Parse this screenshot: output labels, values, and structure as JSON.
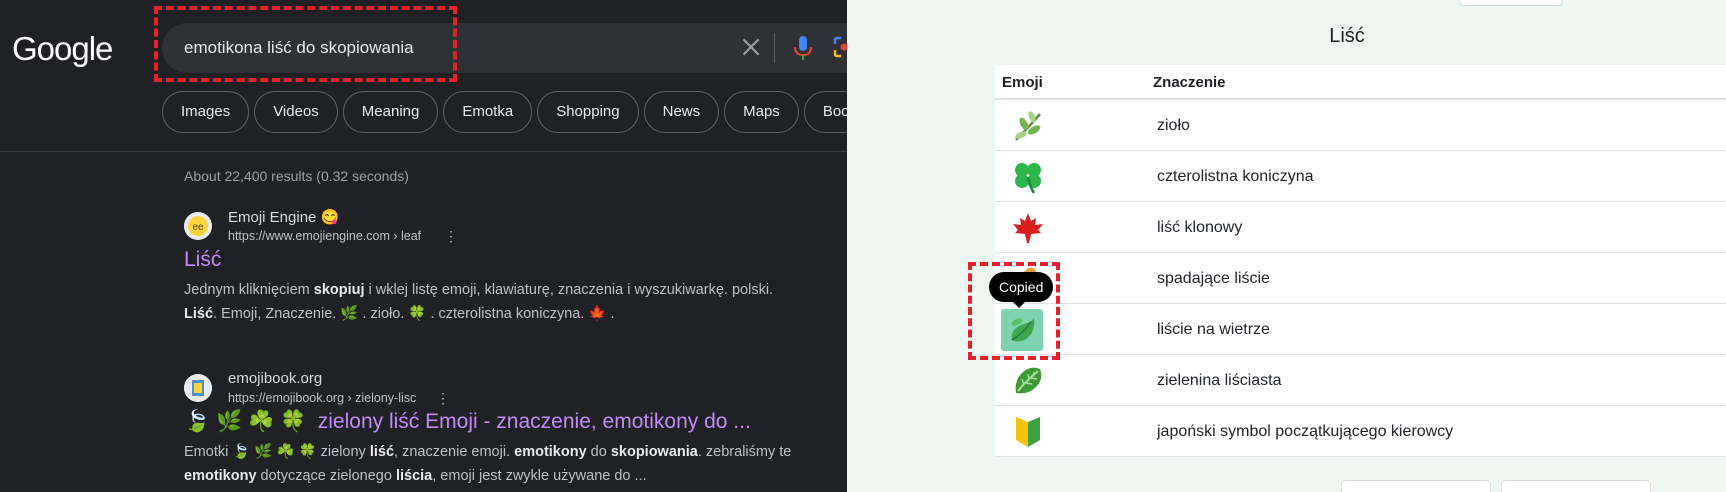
{
  "google": {
    "logo": "Google",
    "query": "emotikona liść do skopiowania",
    "chips": [
      "Images",
      "Videos",
      "Meaning",
      "Emotka",
      "Shopping",
      "News",
      "Maps",
      "Books"
    ],
    "stats": "About 22,400 results (0.32 seconds)",
    "results": [
      {
        "site": "Emoji Engine 😋",
        "url": "https://www.emojiengine.com › leaf",
        "title": "Liść",
        "snippet_parts": [
          "Jednym kliknięciem ",
          "skopiuj",
          " i wklej listę emoji, klawiaturę, znaczenia i wyszukiwarkę. polski. ",
          "Liść",
          ". Emoji, Znaczenie. 🌿 . zioło. 🍀 . czterolistna koniczyna. 🍁 ."
        ]
      },
      {
        "site": "emojibook.org",
        "url": "https://emojibook.org › zielony-lisc",
        "title_emoji": "🍃 🌿 ☘️ 🍀",
        "title": "zielony liść Emoji - znaczenie, emotikony do ...",
        "snippet_parts": [
          "Emotki 🍃 🌿 ☘️ 🍀 zielony ",
          "liść",
          ", znaczenie emoji. ",
          "emotikony",
          " do ",
          "skopiowania",
          ". zebraliśmy te ",
          "emotikony",
          " dotyczące zielonego ",
          "liścia",
          ", emoji jest zwykle używane do ..."
        ]
      }
    ]
  },
  "emoji_page": {
    "title": "Liść",
    "col_emoji": "Emoji",
    "col_meaning": "Znaczenie",
    "rows": [
      {
        "emoji": "herb",
        "meaning": "zioło"
      },
      {
        "emoji": "four-leaf-clover",
        "meaning": "czterolistna koniczyna"
      },
      {
        "emoji": "maple-leaf",
        "meaning": "liść klonowy"
      },
      {
        "emoji": "fallen-leaf",
        "meaning": "spadające liście"
      },
      {
        "emoji": "leaf-fluttering-in-wind",
        "meaning": "liście na wietrze"
      },
      {
        "emoji": "leafy-green",
        "meaning": "zielenina liściasta"
      },
      {
        "emoji": "japanese-beginner-symbol",
        "meaning": "japoński symbol początkującego kierowcy"
      }
    ],
    "tooltip": "Copied"
  },
  "colors": {
    "highlight": "#e8202a",
    "link_purple": "#c58af9",
    "copied_bg": "#7fd3b0"
  }
}
